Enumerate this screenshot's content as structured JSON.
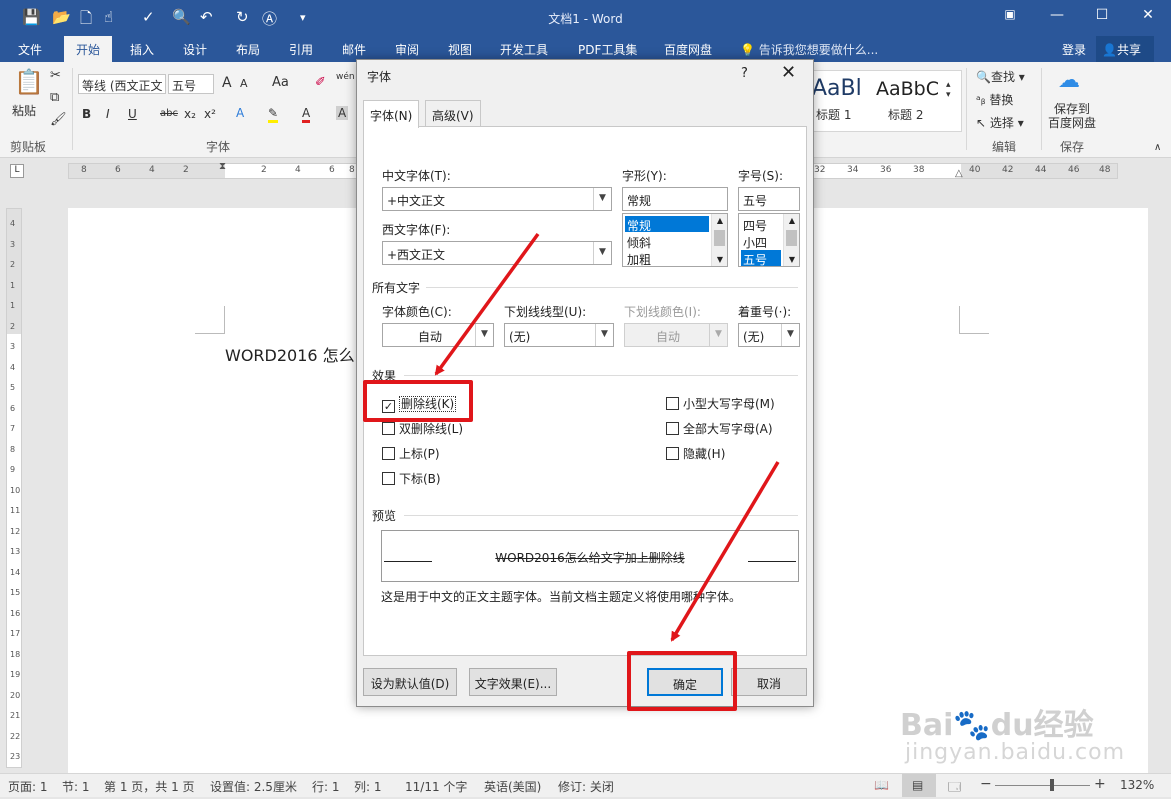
{
  "app": {
    "doc_title": "文档1 - Word",
    "win_min": "—",
    "win_max": "☐",
    "win_close": "✕",
    "ribbon_display": "▣"
  },
  "tabs": [
    "文件",
    "开始",
    "插入",
    "设计",
    "布局",
    "引用",
    "邮件",
    "审阅",
    "视图",
    "开发工具",
    "PDF工具集",
    "百度网盘"
  ],
  "tell_me": "告诉我您想要做什么...",
  "login": "登录",
  "share": "共享",
  "ribbon": {
    "paste": "粘贴",
    "clipboard_group": "剪贴板",
    "font_name": "等线 (西文正文",
    "font_size": "五号",
    "font_group": "字体",
    "style1_sample": "AaBl",
    "style1_label": "标题 1",
    "style2_sample": "AaBbC",
    "style2_label": "标题 2",
    "find": "查找",
    "replace": "替换",
    "select": "选择",
    "edit_group": "编辑",
    "save_baidu": "保存到\n百度网盘",
    "save_group": "保存",
    "bold": "B",
    "italic": "I",
    "underline": "U",
    "strike": "abc",
    "sub": "x₂",
    "sup": "x²",
    "grow": "A",
    "shrink": "A",
    "case": "Aa",
    "highlight_a": "A",
    "color_a": "A",
    "char_a": "A",
    "wen": "wén"
  },
  "ruler": {
    "h_left": [
      "8",
      "6",
      "4",
      "2",
      "2",
      "4",
      "6",
      "8"
    ],
    "h_right": [
      "32",
      "34",
      "36",
      "38",
      "40",
      "42",
      "44",
      "46",
      "48"
    ],
    "v": [
      "4",
      "3",
      "2",
      "1",
      "1",
      "2",
      "3",
      "4",
      "5",
      "6",
      "7",
      "8",
      "9",
      "10",
      "11",
      "12",
      "13",
      "14",
      "15",
      "16",
      "17",
      "18",
      "19",
      "20",
      "21",
      "22",
      "23"
    ]
  },
  "document": {
    "text": "WORD2016 怎么"
  },
  "watermark": {
    "line1": "Bai",
    "line1b": "du",
    "line1c": "经验",
    "line2": "jingyan.baidu.com"
  },
  "dialog": {
    "title": "字体",
    "help": "?",
    "close": "✕",
    "tab_font": "字体(N)",
    "tab_advanced": "高级(V)",
    "cn_font_label": "中文字体(T):",
    "cn_font_value": "+中文正文",
    "west_font_label": "西文字体(F):",
    "west_font_value": "+西文正文",
    "style_label": "字形(Y):",
    "style_value": "常规",
    "style_options": [
      "常规",
      "倾斜",
      "加粗"
    ],
    "size_label": "字号(S):",
    "size_value": "五号",
    "size_options": [
      "四号",
      "小四",
      "五号"
    ],
    "all_text": "所有文字",
    "font_color_label": "字体颜色(C):",
    "font_color_value": "自动",
    "underline_label": "下划线线型(U):",
    "underline_value": "(无)",
    "underline_color_label": "下划线颜色(I):",
    "underline_color_value": "自动",
    "emphasis_label": "着重号(·):",
    "emphasis_value": "(无)",
    "effects": "效果",
    "strikethrough": "删除线(K)",
    "double_strike": "双删除线(L)",
    "superscript": "上标(P)",
    "subscript": "下标(B)",
    "small_caps": "小型大写字母(M)",
    "all_caps": "全部大写字母(A)",
    "hidden": "隐藏(H)",
    "check_mark": "✓",
    "preview": "预览",
    "preview_text": "WORD2016怎么给文字加上删除线",
    "note": "这是用于中文的正文主题字体。当前文档主题定义将使用哪种字体。",
    "set_default": "设为默认值(D)",
    "text_effects": "文字效果(E)...",
    "ok": "确定",
    "cancel": "取消"
  },
  "status": {
    "page": "页面: 1",
    "section": "节: 1",
    "pages": "第 1 页，共 1 页",
    "position": "设置值: 2.5厘米",
    "line": "行: 1",
    "col": "列: 1",
    "words": "11/11 个字",
    "lang": "英语(美国)",
    "track": "修订: 关闭",
    "zoom_minus": "−",
    "zoom_plus": "+",
    "zoom": "132%",
    "zoom_level": 0.6
  },
  "colors": {
    "accent": "#2b579a",
    "highlight_red": "#e0161a"
  }
}
